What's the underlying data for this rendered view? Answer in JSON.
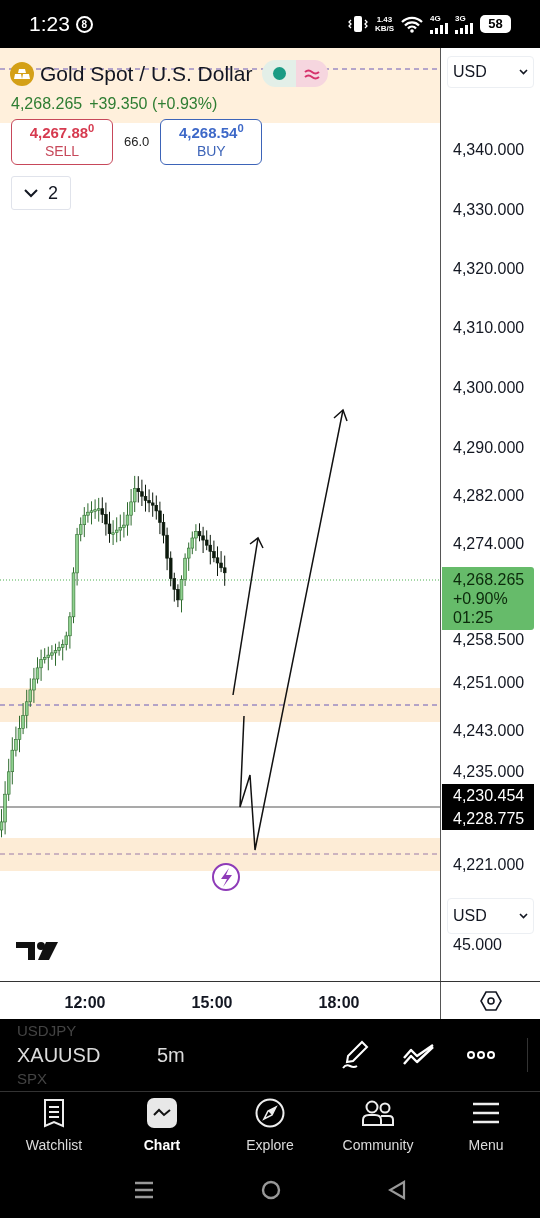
{
  "status_bar": {
    "time": "1:23",
    "badge": "8",
    "network_speed": [
      "1.43",
      "KB/S"
    ],
    "signal_4g": "4G",
    "signal_3g": "3G",
    "battery": "58"
  },
  "symbol": {
    "title": "Gold Spot / U.S. Dollar",
    "market_open": true,
    "price": "4,268.265",
    "change": "+39.350 (+0.93%)"
  },
  "trade": {
    "sell_price": "4,267.88$^{0}$",
    "sell_label": "SELL",
    "spread": "66.0",
    "buy_price": "4,268.54$^{0}$",
    "buy_label": "BUY"
  },
  "indicators_toggle": {
    "count": "2",
    "expanded": false
  },
  "price_axis": {
    "currency": "USD",
    "labels": [
      "4,340.000",
      "4,330.000",
      "4,320.000",
      "4,310.000",
      "4,300.000",
      "4,290.000",
      "4,282.000",
      "4,274.000",
      "4,258.500",
      "4,251.000",
      "4,243.000",
      "4,235.000",
      "4,221.000"
    ],
    "last_price": {
      "price": "4,268.265",
      "change": "+0.90%",
      "countdown": "01:25"
    },
    "crosshair_labels": [
      "4,230.454",
      "4,228.775"
    ]
  },
  "volume_axis": {
    "currency": "USD",
    "label": "45.000"
  },
  "time_axis": {
    "labels": [
      "12:00",
      "15:00",
      "18:00"
    ]
  },
  "toolbar": {
    "symbols": [
      {
        "label": "USDJPY",
        "selected": false
      },
      {
        "label": "XAUUSD",
        "selected": true
      },
      {
        "label": "SPX",
        "selected": false
      }
    ],
    "interval": "5m"
  },
  "nav": [
    {
      "kind": "watchlist",
      "label": "Watchlist",
      "selected": false
    },
    {
      "kind": "chart",
      "label": "Chart",
      "selected": true
    },
    {
      "kind": "explore",
      "label": "Explore",
      "selected": false
    },
    {
      "kind": "community",
      "label": "Community",
      "selected": false
    },
    {
      "kind": "menu",
      "label": "Menu",
      "selected": false
    }
  ]
}
